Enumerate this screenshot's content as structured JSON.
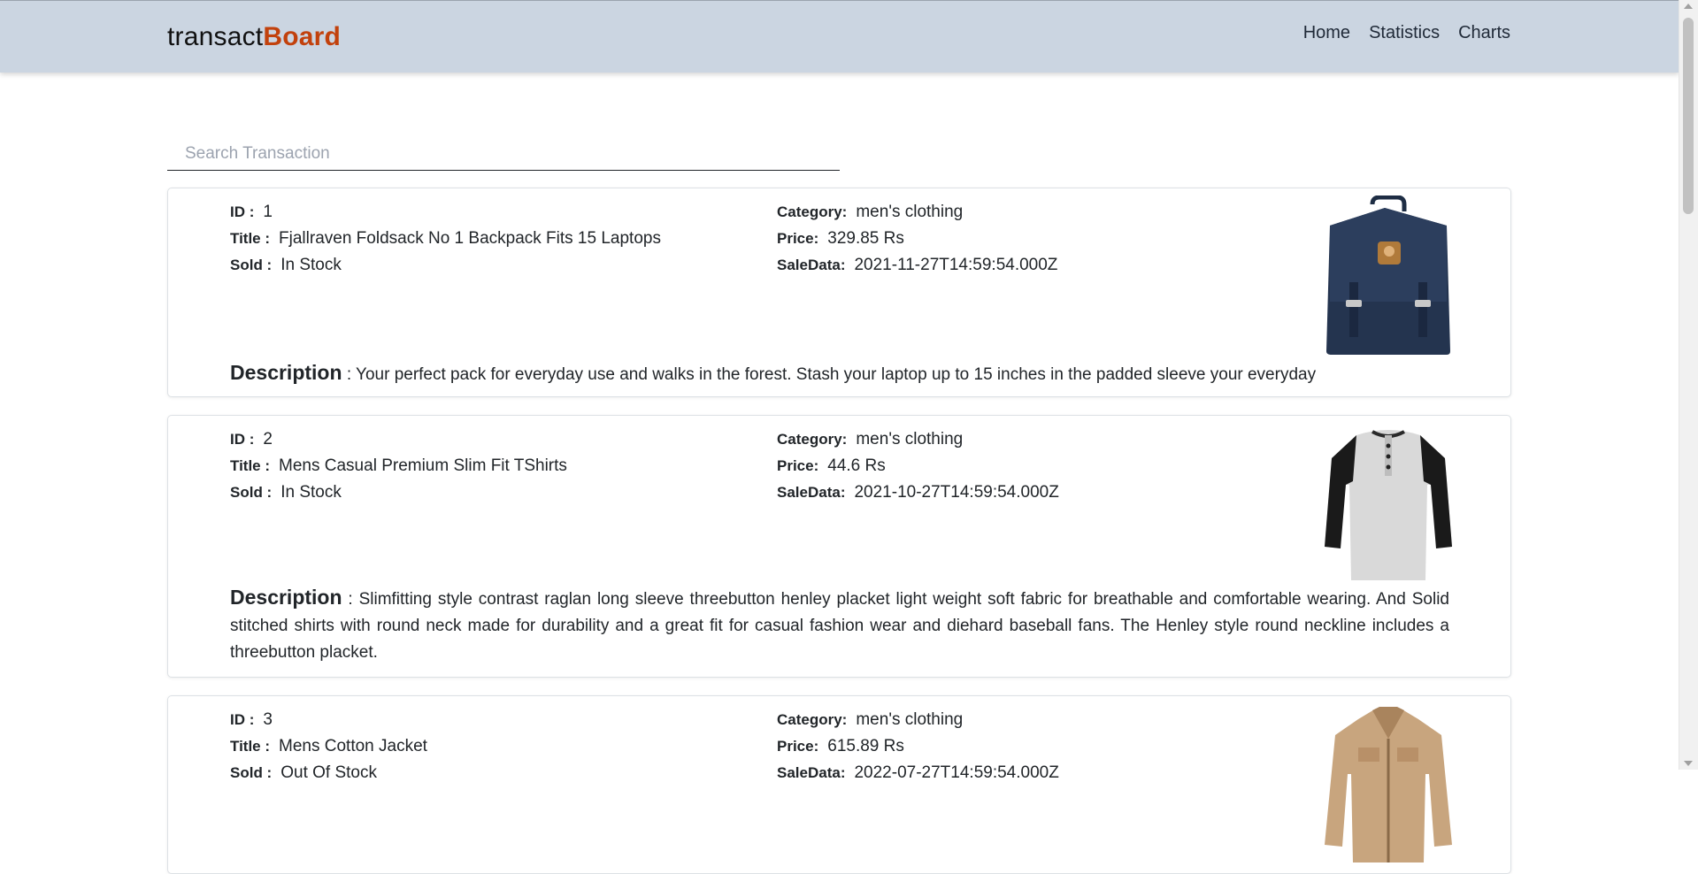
{
  "navbar": {
    "brand_part1": "transact",
    "brand_part2": "Board",
    "links": [
      "Home",
      "Statistics",
      "Charts"
    ]
  },
  "search": {
    "placeholder": "Search Transaction",
    "value": ""
  },
  "labels": {
    "id": "ID :",
    "title": "Title :",
    "sold": "Sold :",
    "category": "Category:",
    "price": "Price:",
    "sale_date": "SaleData:",
    "description": "Description"
  },
  "transactions": [
    {
      "id": "1",
      "title": "Fjallraven Foldsack No 1 Backpack Fits 15 Laptops",
      "sold": "In Stock",
      "category": "men's clothing",
      "price": "329.85 Rs",
      "sale_date": "2021-11-27T14:59:54.000Z",
      "description": ": Your perfect pack for everyday use and walks in the forest. Stash your laptop up to 15 inches in the padded sleeve your everyday",
      "image_icon": "backpack-image"
    },
    {
      "id": "2",
      "title": "Mens Casual Premium Slim Fit TShirts",
      "sold": "In Stock",
      "category": "men's clothing",
      "price": "44.6 Rs",
      "sale_date": "2021-10-27T14:59:54.000Z",
      "description": ": Slimfitting style contrast raglan long sleeve threebutton henley placket light weight soft fabric for breathable and comfortable wearing. And Solid stitched shirts with round neck made for durability and a great fit for casual fashion wear and diehard baseball fans. The Henley style round neckline includes a threebutton placket.",
      "image_icon": "tshirt-image"
    },
    {
      "id": "3",
      "title": "Mens Cotton Jacket",
      "sold": "Out Of Stock",
      "category": "men's clothing",
      "price": "615.89 Rs",
      "sale_date": "2022-07-27T14:59:54.000Z",
      "description": "",
      "image_icon": "jacket-image"
    }
  ],
  "colors": {
    "navbar_bg": "#cbd5e1",
    "brand_accent": "#c2410c"
  }
}
